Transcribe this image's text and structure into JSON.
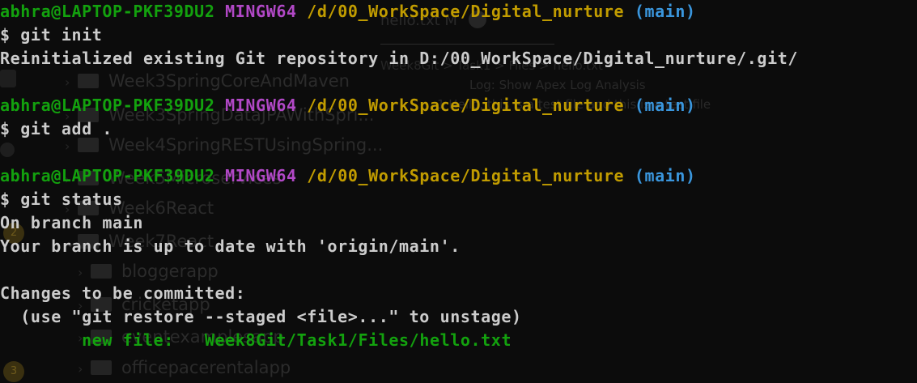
{
  "terminal": {
    "background": "#0c0c0c",
    "colors": {
      "user_host": "#13a10e",
      "shell": "#b148c6",
      "path": "#c19c00",
      "branch": "#3a96dd",
      "text": "#cccccc",
      "staged": "#13a10e"
    },
    "blocks": [
      {
        "prompt": {
          "user_host": "abhra@LAPTOP-PKF39DU2",
          "shell": "MINGW64",
          "path": "/d/00_WorkSpace/Digital_nurture",
          "branch": "(main)"
        },
        "command": "$ git init",
        "output": [
          "Reinitialized existing Git repository in D:/00_WorkSpace/Digital_nurture/.git/"
        ]
      },
      {
        "prompt": {
          "user_host": "abhra@LAPTOP-PKF39DU2",
          "shell": "MINGW64",
          "path": "/d/00_WorkSpace/Digital_nurture",
          "branch": "(main)"
        },
        "command": "$ git add .",
        "output": []
      },
      {
        "prompt": {
          "user_host": "abhra@LAPTOP-PKF39DU2",
          "shell": "MINGW64",
          "path": "/d/00_WorkSpace/Digital_nurture",
          "branch": "(main)"
        },
        "command": "$ git status",
        "output": [
          "On branch main",
          "Your branch is up to date with 'origin/main'.",
          "",
          "Changes to be committed:",
          "  (use \"git restore --staged <file>...\" to unstage)"
        ],
        "staged_file": {
          "label": "new file:",
          "path": "Week8Git/Task1/Files/hello.txt"
        }
      }
    ]
  },
  "background_window": {
    "tab_title": "hello.txt M",
    "tab_bar_text": "Week8Git  >  Task1  >  Files  >  hello.txt",
    "log_title": "Log: Show Apex Log Analysis",
    "editor_line": "1    Hello, this is a test file and this is a test file",
    "folders": [
      "Week3SpringCoreAndMaven",
      "Week3SpringDataJPAWithSpri...",
      "Week4SpringRESTUsingSpring...",
      "Week5Microservices",
      "Week6React",
      "Week7React",
      "bloggerapp",
      "cricketapp",
      "eventexamplesapp",
      "officepacerentalapp"
    ],
    "badges": [
      "2",
      "3"
    ]
  }
}
